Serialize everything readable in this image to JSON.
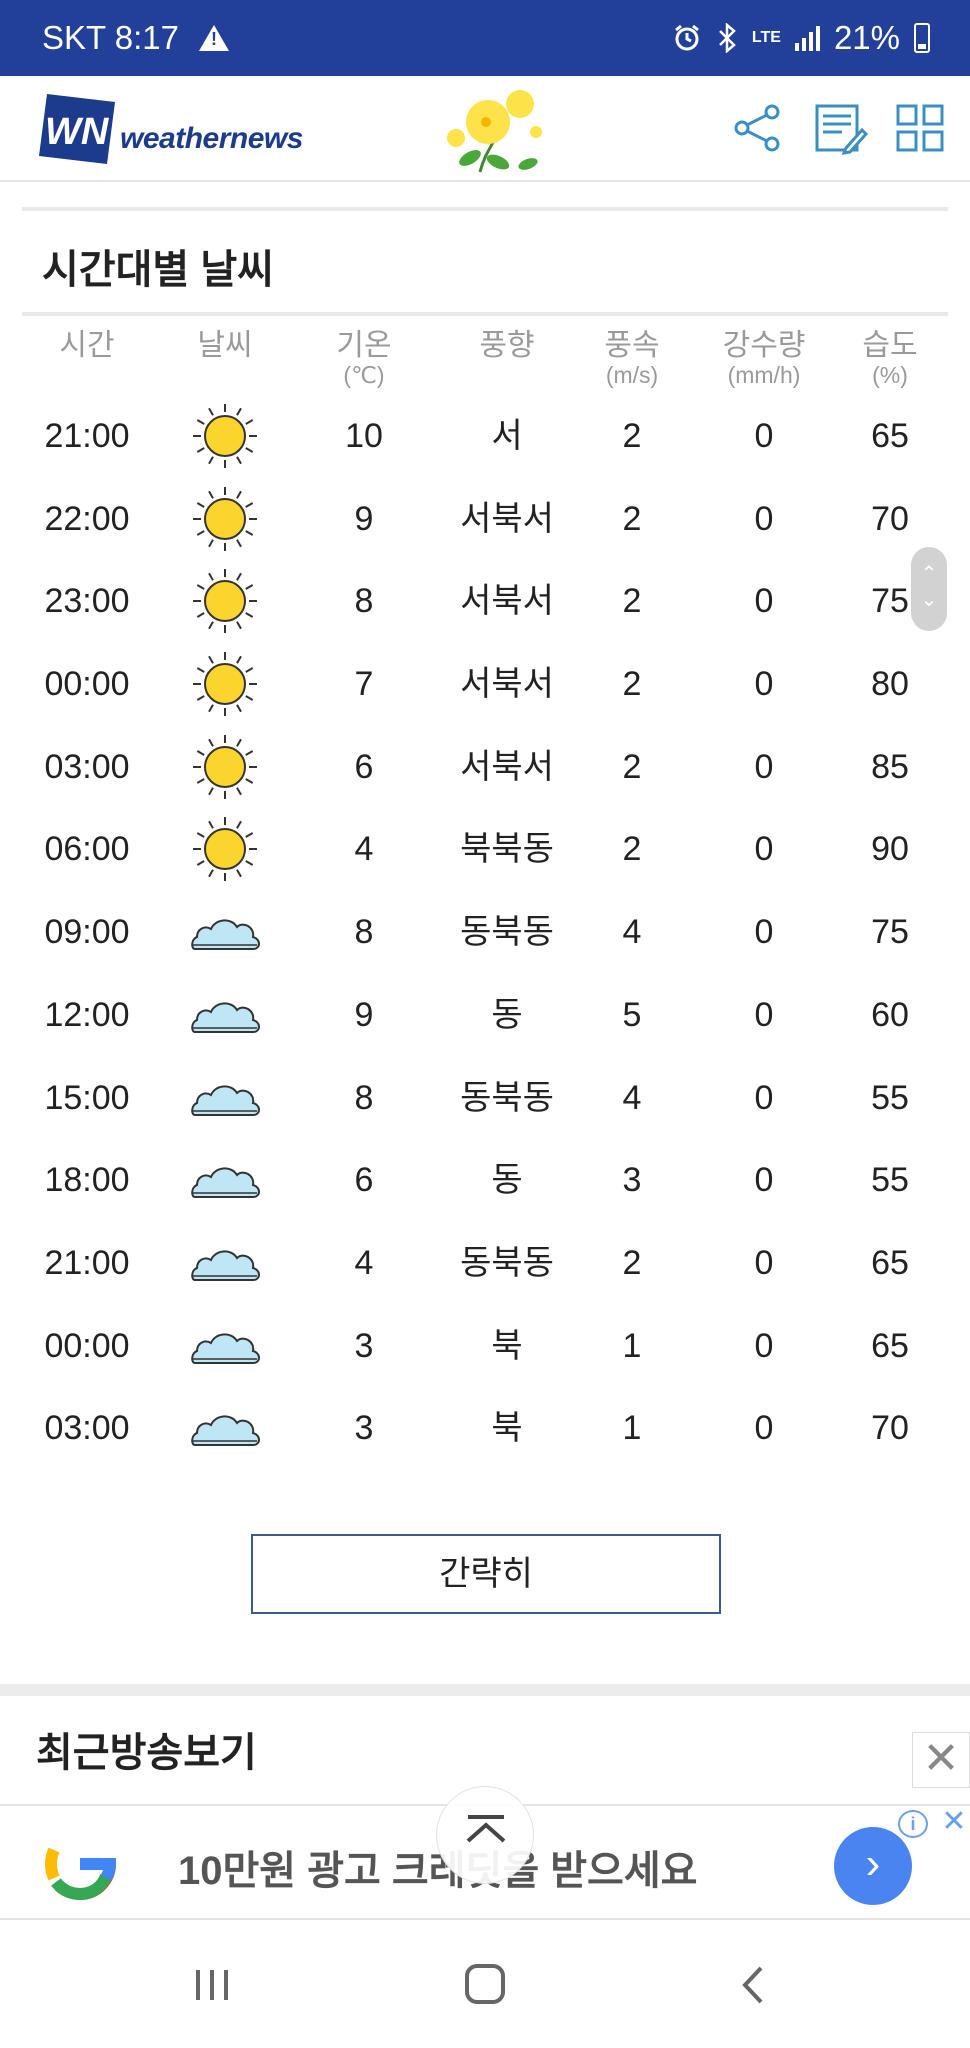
{
  "status_bar": {
    "carrier_time": "SKT 8:17",
    "network": "LTE",
    "battery": "21%",
    "bg_color": "#22409a"
  },
  "header": {
    "logo_mark": "WN",
    "logo_text": "weathernews",
    "icons": [
      "share-icon",
      "memo-icon",
      "grid-menu-icon"
    ],
    "accent_color": "#3a8fc0"
  },
  "hourly": {
    "title": "시간대별 날씨",
    "columns": [
      {
        "label": "시간",
        "unit": ""
      },
      {
        "label": "날씨",
        "unit": ""
      },
      {
        "label": "기온",
        "unit": "(℃)"
      },
      {
        "label": "풍향",
        "unit": ""
      },
      {
        "label": "풍속",
        "unit": "(m/s)"
      },
      {
        "label": "강수량",
        "unit": "(mm/h)"
      },
      {
        "label": "습도",
        "unit": "(%)"
      }
    ],
    "rows": [
      {
        "time": "21:00",
        "weather": "sunny",
        "temp": "10",
        "wind_dir": "서",
        "wind_speed": "2",
        "precip": "0",
        "humidity": "65"
      },
      {
        "time": "22:00",
        "weather": "sunny",
        "temp": "9",
        "wind_dir": "서북서",
        "wind_speed": "2",
        "precip": "0",
        "humidity": "70"
      },
      {
        "time": "23:00",
        "weather": "sunny",
        "temp": "8",
        "wind_dir": "서북서",
        "wind_speed": "2",
        "precip": "0",
        "humidity": "75"
      },
      {
        "time": "00:00",
        "weather": "sunny",
        "temp": "7",
        "wind_dir": "서북서",
        "wind_speed": "2",
        "precip": "0",
        "humidity": "80"
      },
      {
        "time": "03:00",
        "weather": "sunny",
        "temp": "6",
        "wind_dir": "서북서",
        "wind_speed": "2",
        "precip": "0",
        "humidity": "85"
      },
      {
        "time": "06:00",
        "weather": "sunny",
        "temp": "4",
        "wind_dir": "북북동",
        "wind_speed": "2",
        "precip": "0",
        "humidity": "90"
      },
      {
        "time": "09:00",
        "weather": "cloudy",
        "temp": "8",
        "wind_dir": "동북동",
        "wind_speed": "4",
        "precip": "0",
        "humidity": "75"
      },
      {
        "time": "12:00",
        "weather": "cloudy",
        "temp": "9",
        "wind_dir": "동",
        "wind_speed": "5",
        "precip": "0",
        "humidity": "60"
      },
      {
        "time": "15:00",
        "weather": "cloudy",
        "temp": "8",
        "wind_dir": "동북동",
        "wind_speed": "4",
        "precip": "0",
        "humidity": "55"
      },
      {
        "time": "18:00",
        "weather": "cloudy",
        "temp": "6",
        "wind_dir": "동",
        "wind_speed": "3",
        "precip": "0",
        "humidity": "55"
      },
      {
        "time": "21:00",
        "weather": "cloudy",
        "temp": "4",
        "wind_dir": "동북동",
        "wind_speed": "2",
        "precip": "0",
        "humidity": "65"
      },
      {
        "time": "00:00",
        "weather": "cloudy",
        "temp": "3",
        "wind_dir": "북",
        "wind_speed": "1",
        "precip": "0",
        "humidity": "65"
      },
      {
        "time": "03:00",
        "weather": "cloudy",
        "temp": "3",
        "wind_dir": "북",
        "wind_speed": "1",
        "precip": "0",
        "humidity": "70"
      }
    ],
    "collapse_label": "간략히"
  },
  "recent": {
    "title": "최근방송보기"
  },
  "ad": {
    "text": "10만원 광고 크레딧을 받으세요",
    "close_glyph": "✕",
    "info_glyph": "i",
    "arrow_glyph": "›",
    "arrow_color": "#4a84f0"
  },
  "nav": {
    "buttons": [
      "recent-apps-icon",
      "home-icon",
      "back-icon"
    ]
  }
}
